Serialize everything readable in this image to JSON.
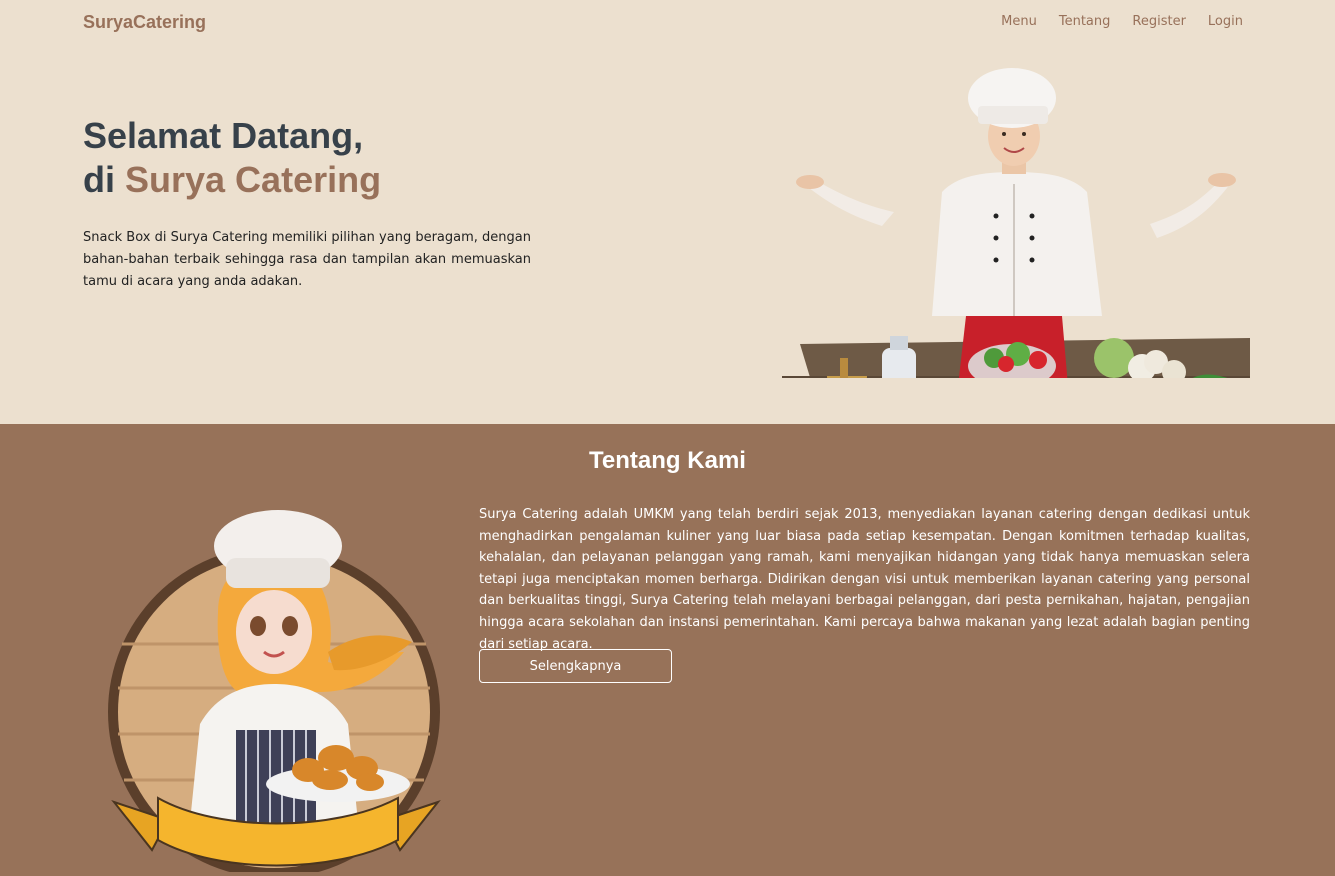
{
  "nav": {
    "brand": "SuryaCatering",
    "links": [
      "Menu",
      "Tentang",
      "Register",
      "Login"
    ]
  },
  "hero": {
    "title_line1": "Selamat Datang,",
    "title_prefix": "di ",
    "title_accent": "Surya Catering",
    "description": "Snack Box di Surya Catering memiliki pilihan yang beragam, dengan bahan-bahan terbaik sehingga rasa dan tampilan akan memuaskan tamu di acara yang anda adakan."
  },
  "about": {
    "title": "Tentang Kami",
    "text": "Surya Catering adalah UMKM yang telah berdiri sejak 2013, menyediakan layanan catering dengan dedikasi untuk menghadirkan pengalaman kuliner yang luar biasa pada setiap kesempatan. Dengan komitmen terhadap kualitas, kehalalan, dan pelayanan pelanggan yang ramah, kami menyajikan hidangan yang tidak hanya memuaskan selera tetapi juga menciptakan momen berharga. Didirikan dengan visi untuk memberikan layanan catering yang personal dan berkualitas tinggi, Surya Catering telah melayani berbagai pelanggan, dari pesta pernikahan, hajatan, pengajian hingga acara sekolahan dan instansi pemerintahan. Kami percaya bahwa makanan yang lezat adalah bagian penting dari setiap acara.",
    "button_label": "Selengkapnya"
  },
  "colors": {
    "hero_bg": "#ece0cf",
    "about_bg": "#977259",
    "accent": "#98715a",
    "heading": "#37414a"
  }
}
